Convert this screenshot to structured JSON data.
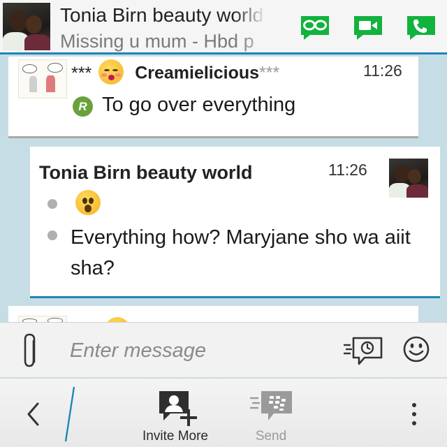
{
  "header": {
    "contact_name": "Tonia Birn  beauty world",
    "status_message": "Missing u mum - Hbd p",
    "actions": {
      "glympse_icon": "mask-glasses-icon",
      "video_icon": "video-call-icon",
      "voice_icon": "phone-icon"
    }
  },
  "messages": [
    {
      "sender_prefix": "***",
      "sender_name": "Creamielicious",
      "sender_suffix": "***",
      "time": "11:26",
      "status_badge": "R",
      "text": "To go over everything"
    },
    {
      "sender_name": "Tonia Birn  beauty world",
      "time": "11:26",
      "text": "Everything how? Maryjane sho wa aiit sha?"
    }
  ],
  "composer": {
    "placeholder": "Enter message"
  },
  "action_bar": {
    "invite_label": "Invite More",
    "send_label": "Send"
  },
  "colors": {
    "accent_blue": "#1d86b8",
    "action_green": "#12b23e",
    "read_badge_green": "#6aa13a"
  }
}
